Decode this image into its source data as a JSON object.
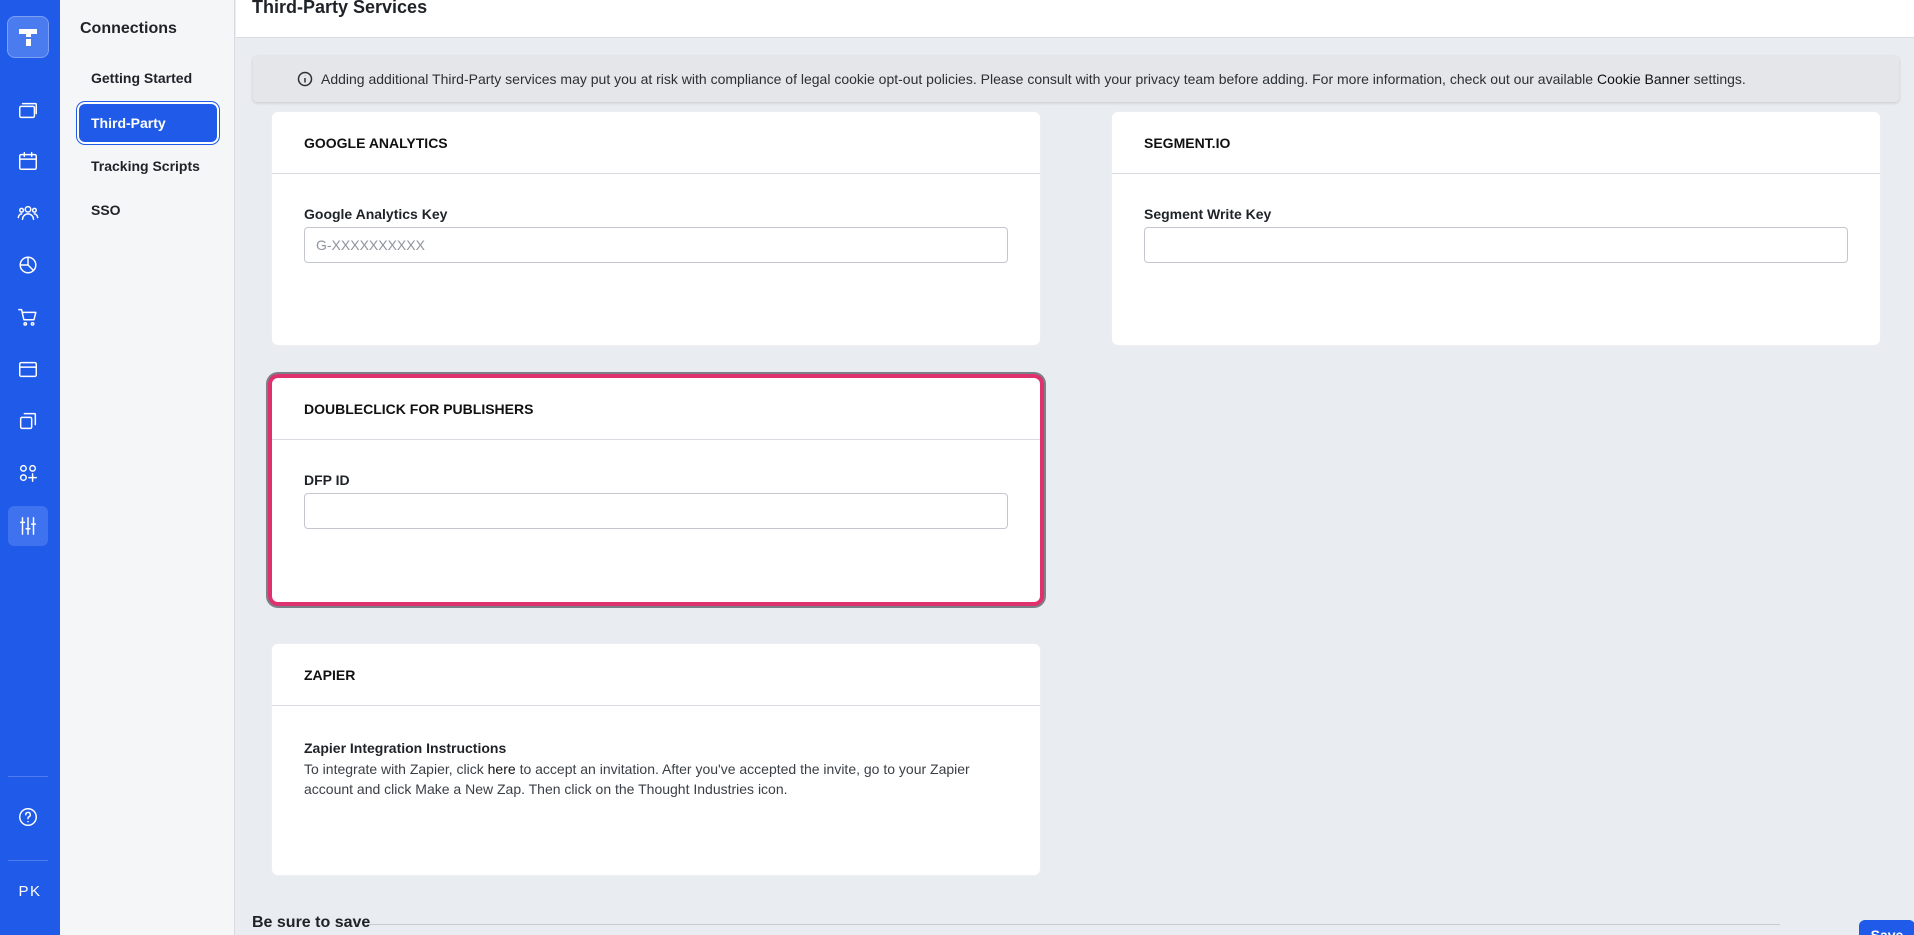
{
  "rail": {
    "icons": [
      "logo-icon",
      "courses-icon",
      "calendar-icon",
      "users-icon",
      "reports-icon",
      "cart-icon",
      "window-icon",
      "copy-icon",
      "apps-icon",
      "settings-sliders-icon",
      "help-icon"
    ],
    "initials": "PK",
    "accent_color": "#1f5ae8"
  },
  "subnav": {
    "title": "Connections",
    "items": [
      {
        "label": "Getting Started",
        "active": false
      },
      {
        "label": "Third-Party",
        "active": true
      },
      {
        "label": "Tracking Scripts",
        "active": false
      },
      {
        "label": "SSO",
        "active": false
      }
    ]
  },
  "header": {
    "title": "Third-Party Services"
  },
  "alert": {
    "icon": "info-icon",
    "text_before": "Adding additional Third-Party services may put you at risk with compliance of legal cookie opt-out policies. Please consult with your privacy team before adding. For more information, check out our available",
    "link": "Cookie Banner",
    "text_after": "settings."
  },
  "cards": {
    "google": {
      "title": "GOOGLE ANALYTICS",
      "field_label": "Google Analytics Key",
      "value": "",
      "placeholder": "G-XXXXXXXXXX"
    },
    "segment": {
      "title": "SEGMENT.IO",
      "field_label": "Segment Write Key",
      "value": "",
      "placeholder": ""
    },
    "doubleclick": {
      "title": "DOUBLECLICK FOR PUBLISHERS",
      "field_label": "DFP ID",
      "value": "",
      "placeholder": "",
      "highlight_color": "#e0316f"
    },
    "zapier": {
      "title": "ZAPIER",
      "subtitle": "Zapier Integration Instructions",
      "text_before": "To integrate with Zapier, click",
      "link": "here",
      "text_after": "to accept an invitation. After you've accepted the invite, go to your Zapier account and click Make a New Zap. Then click on the Thought Industries icon."
    }
  },
  "footer": {
    "reminder": "Be sure to save",
    "save_label": "Save"
  }
}
